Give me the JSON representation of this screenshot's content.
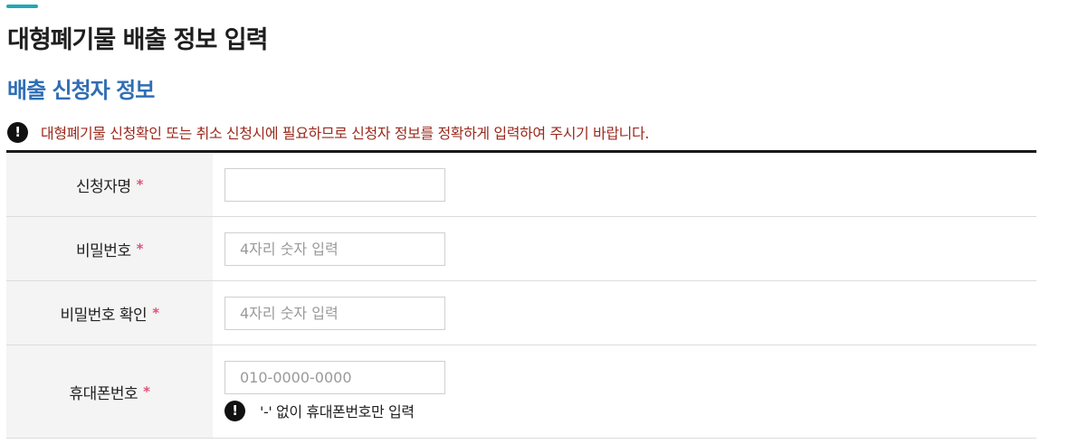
{
  "page": {
    "title": "대형폐기물 배출 정보 입력",
    "accent_color": "#23a7b5"
  },
  "section": {
    "title": "배출 신청자 정보",
    "title_color": "#2f6eb3"
  },
  "notice": {
    "icon": "exclamation-circle-icon",
    "text": "대형폐기물 신청확인 또는 취소 신청시에 필요하므로 신청자 정보를 정확하게 입력하여 주시기 바랍니다.",
    "color": "#9a2a1d"
  },
  "form": {
    "required_marker": "*",
    "fields": [
      {
        "label": "신청자명",
        "value": "",
        "placeholder": ""
      },
      {
        "label": "비밀번호",
        "value": "",
        "placeholder": "4자리 숫자 입력"
      },
      {
        "label": "비밀번호 확인",
        "value": "",
        "placeholder": "4자리 숫자 입력"
      },
      {
        "label": "휴대폰번호",
        "value": "",
        "placeholder": "010-0000-0000",
        "hint": "'-' 없이 휴대폰번호만 입력"
      }
    ]
  }
}
